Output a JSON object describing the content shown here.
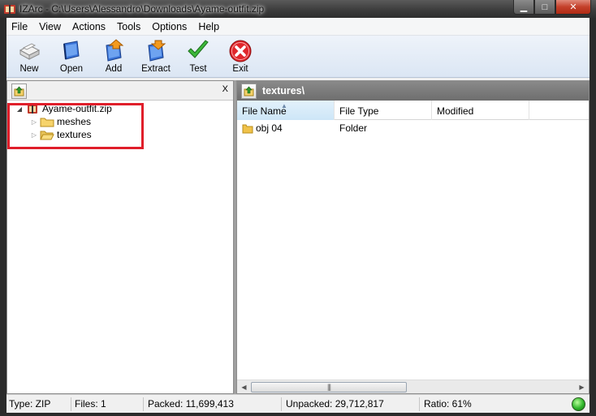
{
  "window": {
    "title": "IZArc - C:\\Users\\Alessandro\\Downloads\\Ayame-outfit.zip",
    "min_glyph": "▁",
    "max_glyph": "□",
    "close_glyph": "✕"
  },
  "menu": [
    "File",
    "View",
    "Actions",
    "Tools",
    "Options",
    "Help"
  ],
  "toolbar": [
    {
      "label": "New",
      "icon": "new-archive-icon"
    },
    {
      "label": "Open",
      "icon": "open-archive-icon"
    },
    {
      "label": "Add",
      "icon": "add-files-icon"
    },
    {
      "label": "Extract",
      "icon": "extract-icon"
    },
    {
      "label": "Test",
      "icon": "checkmark-icon"
    },
    {
      "label": "Exit",
      "icon": "exit-icon"
    }
  ],
  "left_pane": {
    "close_label": "X",
    "tree": {
      "root": "Ayame-outfit.zip",
      "children": [
        "meshes",
        "textures"
      ]
    }
  },
  "right_pane": {
    "path": "textures\\",
    "columns": [
      "File Name",
      "File Type",
      "Modified"
    ],
    "rows": [
      {
        "name": "obj 04",
        "type": "Folder",
        "modified": ""
      }
    ]
  },
  "statusbar": {
    "type": "Type: ZIP",
    "files": "Files: 1",
    "packed": "Packed: 11,699,413",
    "unpacked": "Unpacked: 29,712,817",
    "ratio": "Ratio: 61%"
  },
  "colors": {
    "highlight_box": "#e01e2a",
    "status_led": "#2fb52a"
  }
}
